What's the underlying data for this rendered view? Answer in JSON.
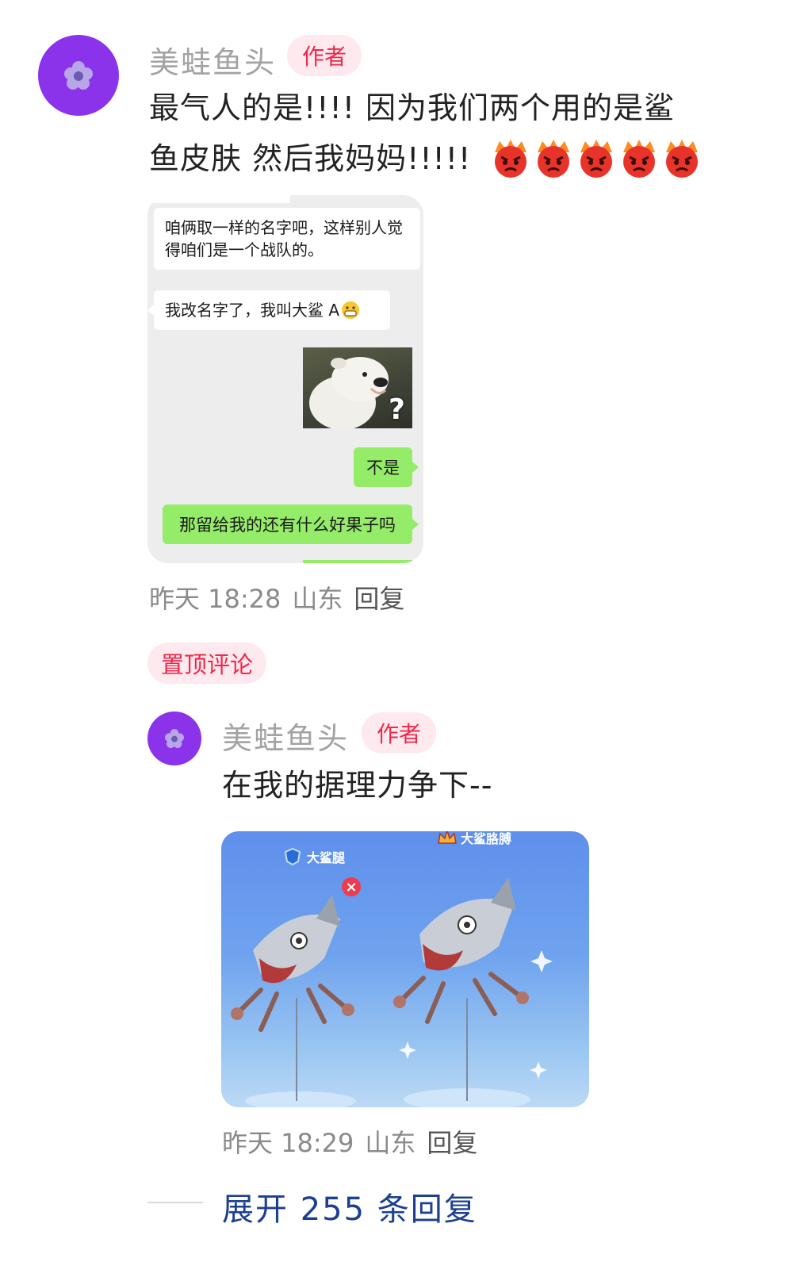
{
  "comment": {
    "username": "美蛙鱼头",
    "author_badge": "作者",
    "text_line1": "最气人的是!!!!  因为我们两个用的是鲨",
    "text_line2": "鱼皮肤 然后我妈妈!!!!!",
    "emoji": "angry-face-emoji",
    "chat_screenshot": {
      "msg1": "咱俩取一样的名字吧，这样别人觉得咱们是一个战队的。",
      "msg2": "我改名字了，我叫大鲨 A",
      "msg2_emoji": "grinning-face-emoji",
      "msg3_image": "white-dog-question-meme",
      "msg3_overlay": "?",
      "msg4": "不是",
      "msg5": "那留给我的还有什么好果子吗"
    },
    "meta": {
      "time": "昨天 18:28",
      "location": "山东",
      "reply": "回复"
    }
  },
  "pinned_label": "置顶评论",
  "reply": {
    "username": "美蛙鱼头",
    "author_badge": "作者",
    "text": "在我的据理力争下--",
    "image": {
      "left_name": "大鲨腿",
      "right_name": "大鲨胳膊",
      "close_symbol": "×",
      "subject": "shark-crab-skin"
    },
    "meta": {
      "time": "昨天 18:29",
      "location": "山东",
      "reply": "回复"
    }
  },
  "expand": {
    "label": "展开 255 条回复"
  },
  "colors": {
    "accent_red": "#f0284a",
    "badge_bg": "#fde9ee",
    "link_blue": "#1d3f8f",
    "avatar_purple": "#8a33ea",
    "wechat_green": "#95ec69"
  }
}
